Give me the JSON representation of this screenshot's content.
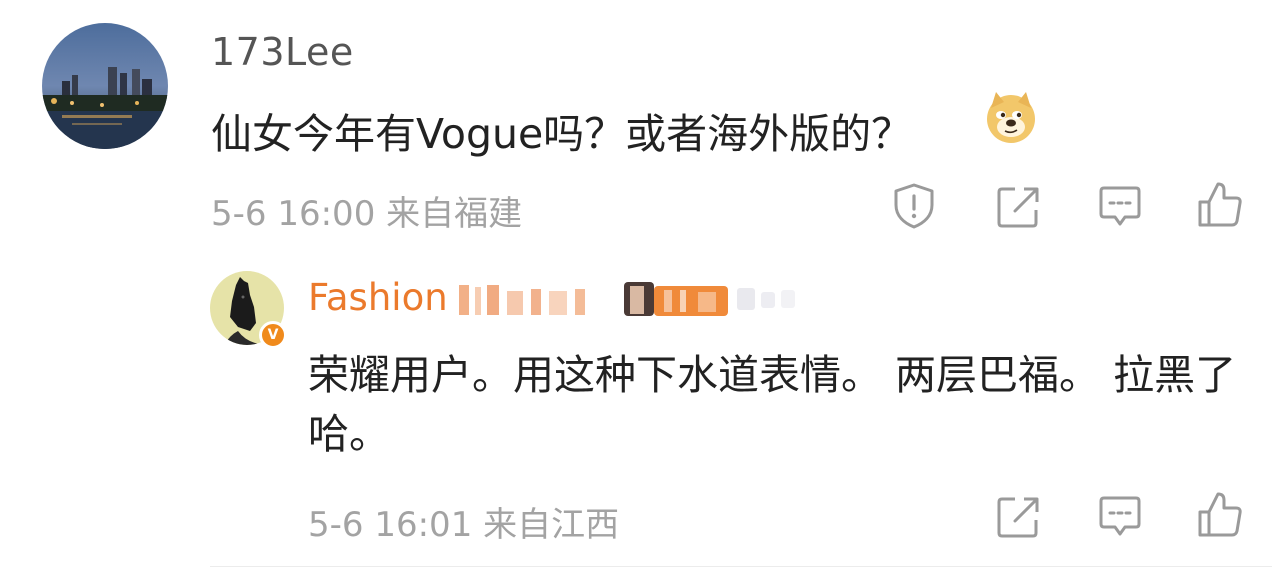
{
  "comment": {
    "username": "173Lee",
    "text": "仙女今年有Vogue吗？或者海外版的？",
    "emoji_icon": "doge-emoji-icon",
    "timestamp": "5-6 16:00",
    "location": "来自福建",
    "actions": [
      "report-icon",
      "repost-icon",
      "reply-icon",
      "like-icon"
    ]
  },
  "reply": {
    "username_visible": "Fashion",
    "verified_badge": "V",
    "text": "荣耀用户。用这种下水道表情。 两层巴福。 拉黑了哈。",
    "timestamp": "5-6 16:01",
    "location": "来自江西",
    "actions": [
      "repost-icon",
      "reply-icon",
      "like-icon"
    ]
  },
  "colors": {
    "username_reply": "#eb7a2c",
    "meta_text": "#a3a3a3",
    "body_text": "#222222",
    "icon_gray": "#9a9a9a",
    "verified_orange": "#f08a1c"
  }
}
